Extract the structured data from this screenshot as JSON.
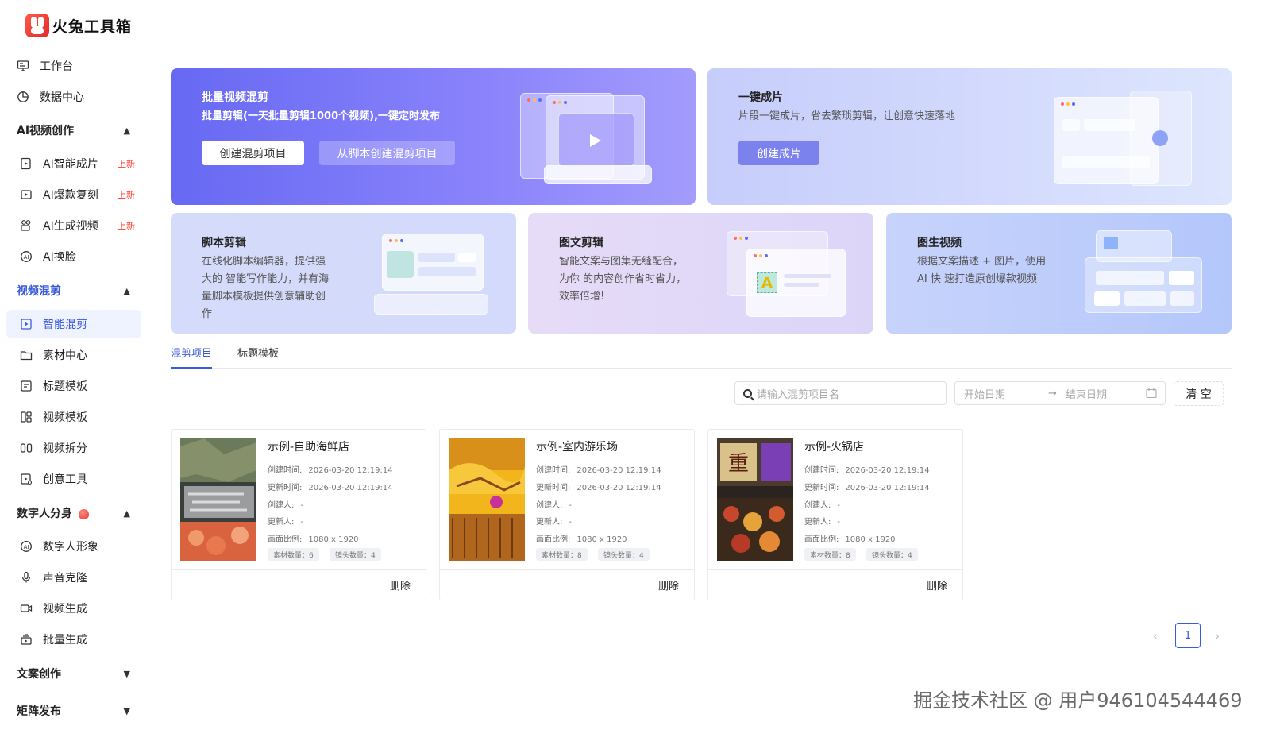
{
  "app": {
    "title": "火兔工具箱"
  },
  "sidebar": {
    "top_items": [
      {
        "label": "工作台",
        "icon": "monitor-icon"
      },
      {
        "label": "数据中心",
        "icon": "pie-chart-icon"
      }
    ],
    "groups": [
      {
        "label": "AI视频创作",
        "expanded": true,
        "items": [
          {
            "label": "AI智能成片",
            "badge": "上新"
          },
          {
            "label": "AI爆款复刻",
            "badge": "上新"
          },
          {
            "label": "AI生成视频",
            "badge": "上新"
          },
          {
            "label": "AI换脸",
            "badge": ""
          }
        ]
      },
      {
        "label": "视频混剪",
        "expanded": true,
        "items": [
          {
            "label": "智能混剪",
            "active": true
          },
          {
            "label": "素材中心"
          },
          {
            "label": "标题模板"
          },
          {
            "label": "视频模板"
          },
          {
            "label": "视频拆分"
          },
          {
            "label": "创意工具"
          }
        ]
      },
      {
        "label": "数字人分身",
        "expanded": true,
        "items": [
          {
            "label": "数字人形象"
          },
          {
            "label": "声音克隆"
          },
          {
            "label": "视频生成"
          },
          {
            "label": "批量生成"
          }
        ]
      },
      {
        "label": "文案创作",
        "expanded": false,
        "items": []
      },
      {
        "label": "矩阵发布",
        "expanded": false,
        "items": []
      }
    ]
  },
  "features": {
    "batch": {
      "title": "批量视频混剪",
      "desc": "批量剪辑(一天批量剪辑1000个视频),一键定时发布",
      "btn_primary": "创建混剪项目",
      "btn_secondary": "从脚本创建混剪项目"
    },
    "oneclick": {
      "title": "一键成片",
      "desc": "片段一键成片，省去繁琐剪辑，让创意快速落地",
      "btn": "创建成片"
    },
    "script": {
      "title": "脚本剪辑",
      "desc_lines": [
        "在线化脚本编辑器，提供强",
        "大的 智能写作能力，并有海",
        "量脚本模板提供创意辅助创",
        "作"
      ]
    },
    "imagetext": {
      "title": "图文剪辑",
      "desc_lines": [
        "智能文案与图集无缝配合，",
        "为你 的内容创作省时省力，",
        "效率倍增!"
      ]
    },
    "img2video": {
      "title": "图生视频",
      "desc_lines": [
        "根据文案描述 + 图片，使用",
        "AI 快 速打造原创爆款视频"
      ]
    }
  },
  "tabs": [
    {
      "label": "混剪项目",
      "active": true
    },
    {
      "label": "标题模板",
      "active": false
    }
  ],
  "filters": {
    "search_placeholder": "请输入混剪项目名",
    "start_placeholder": "开始日期",
    "arrow": "→",
    "end_placeholder": "结束日期",
    "clear": "清 空"
  },
  "projects": [
    {
      "name": "示例-自助海鲜店",
      "created_label": "创建时间:",
      "created": "2026-03-20 12:19:14",
      "updated_label": "更新时间:",
      "updated": "2026-03-20 12:19:14",
      "creator_label": "创建人:",
      "creator": "-",
      "updater_label": "更新人:",
      "updater": "-",
      "ratio_label": "画面比例:",
      "ratio": "1080 x 1920",
      "materials": "素材数量：6",
      "shots": "镜头数量：4",
      "delete": "删除"
    },
    {
      "name": "示例-室内游乐场",
      "created_label": "创建时间:",
      "created": "2026-03-20 12:19:14",
      "updated_label": "更新时间:",
      "updated": "2026-03-20 12:19:14",
      "creator_label": "创建人:",
      "creator": "-",
      "updater_label": "更新人:",
      "updater": "-",
      "ratio_label": "画面比例:",
      "ratio": "1080 x 1920",
      "materials": "素材数量：8",
      "shots": "镜头数量：4",
      "delete": "删除"
    },
    {
      "name": "示例-火锅店",
      "created_label": "创建时间:",
      "created": "2026-03-20 12:19:14",
      "updated_label": "更新时间:",
      "updated": "2026-03-20 12:19:14",
      "creator_label": "创建人:",
      "creator": "-",
      "updater_label": "更新人:",
      "updater": "-",
      "ratio_label": "画面比例:",
      "ratio": "1080 x 1920",
      "materials": "素材数量：8",
      "shots": "镜头数量：4",
      "delete": "删除"
    }
  ],
  "pagination": {
    "current": "1",
    "prev": "‹",
    "next": "›"
  },
  "watermark": "掘金技术社区 @ 用户946104544469",
  "colors": {
    "accent": "#3a5bd9",
    "new_badge": "#ff3b30",
    "banner_primary": "#6769f3"
  }
}
